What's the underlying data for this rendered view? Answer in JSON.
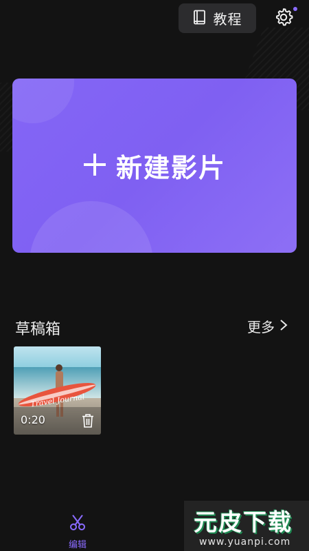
{
  "header": {
    "tutorial_label": "教程",
    "tutorial_icon": "book-icon",
    "settings_icon": "gear-icon",
    "accent_color": "#8a6bff"
  },
  "new_project": {
    "label": "新建影片",
    "icon": "plus-icon",
    "background": "#8466f6"
  },
  "drafts": {
    "title": "草稿箱",
    "more_label": "更多",
    "items": [
      {
        "duration": "0:20",
        "thumbnail_text": "Travel Journal",
        "delete_icon": "trash-icon"
      }
    ]
  },
  "bottom_nav": {
    "items": [
      {
        "label": "编辑",
        "icon": "scissors-icon",
        "active": true
      }
    ]
  },
  "watermark": {
    "title": "元皮下载",
    "url": "www.yuanpi.com"
  }
}
